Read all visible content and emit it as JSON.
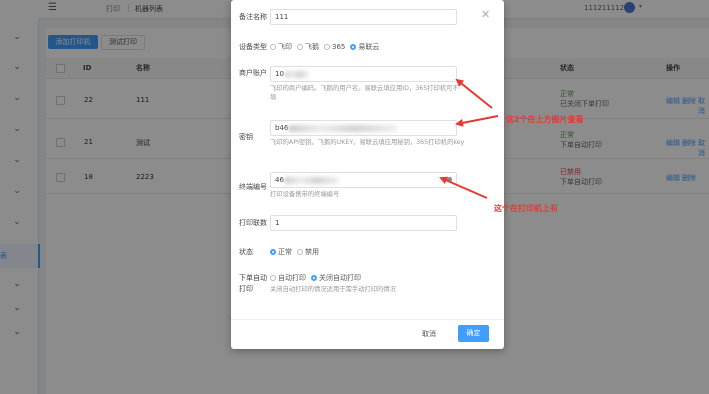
{
  "topbar": {
    "breadcrumb_root": "打印",
    "breadcrumb_current": "机器列表",
    "user": "11121111222"
  },
  "toolbar": {
    "add_printer": "添加打印机",
    "test_print": "测试打印"
  },
  "table": {
    "headers": {
      "id": "ID",
      "name": "名称",
      "status": "状态",
      "ops": "操作"
    },
    "rows": [
      {
        "id": "22",
        "name": "111",
        "status": "正常",
        "substatus": "已关闭下单打印",
        "ops": [
          "编辑",
          "删除",
          "取消"
        ]
      },
      {
        "id": "21",
        "name": "测试",
        "status": "正常",
        "substatus": "下单自动打印",
        "ops": [
          "编辑",
          "删除",
          "取消"
        ]
      },
      {
        "id": "18",
        "name": "2223",
        "status": "已禁用",
        "substatus": "下单自动打印",
        "ops": [
          "编辑",
          "删除"
        ]
      }
    ]
  },
  "sidebar": {
    "active_label": "表"
  },
  "modal": {
    "remark_label": "备注名称",
    "remark_value": "111",
    "device_type_label": "设备类型",
    "device_types": [
      "飞印",
      "飞鹅",
      "365",
      "易联云"
    ],
    "merchant_label": "商户账户",
    "merchant_value": "10",
    "merchant_help": "飞印的商户编码。飞鹅的用户名。易联云填应用ID，365打印机可不填",
    "key_label": "密钥",
    "key_value": "b46",
    "key_help": "飞印的API密钥。飞鹅的UKEY。易联云填应用秘钥，365打印机的key",
    "terminal_label": "终端编号",
    "terminal_value": "46",
    "terminal_help": "打印设备携带的终端编号",
    "copies_label": "打印联数",
    "copies_value": "1",
    "state_label": "状态",
    "states": [
      "正常",
      "禁用"
    ],
    "auto_label_1": "下单自动",
    "auto_label_2": "打印",
    "auto_options": [
      "自动打印",
      "关闭自动打印"
    ],
    "auto_help": "关闭自动打印的情况适用于需手动打印的情况",
    "cancel": "取消",
    "ok": "确定"
  },
  "annotations": {
    "top": "这2个在上方图片查看",
    "bottom": "这个在打印机上有"
  },
  "colors": {
    "primary": "#409eff",
    "annotation": "#e53935",
    "ok": "#4a9e4a",
    "disabled": "#e64242"
  }
}
